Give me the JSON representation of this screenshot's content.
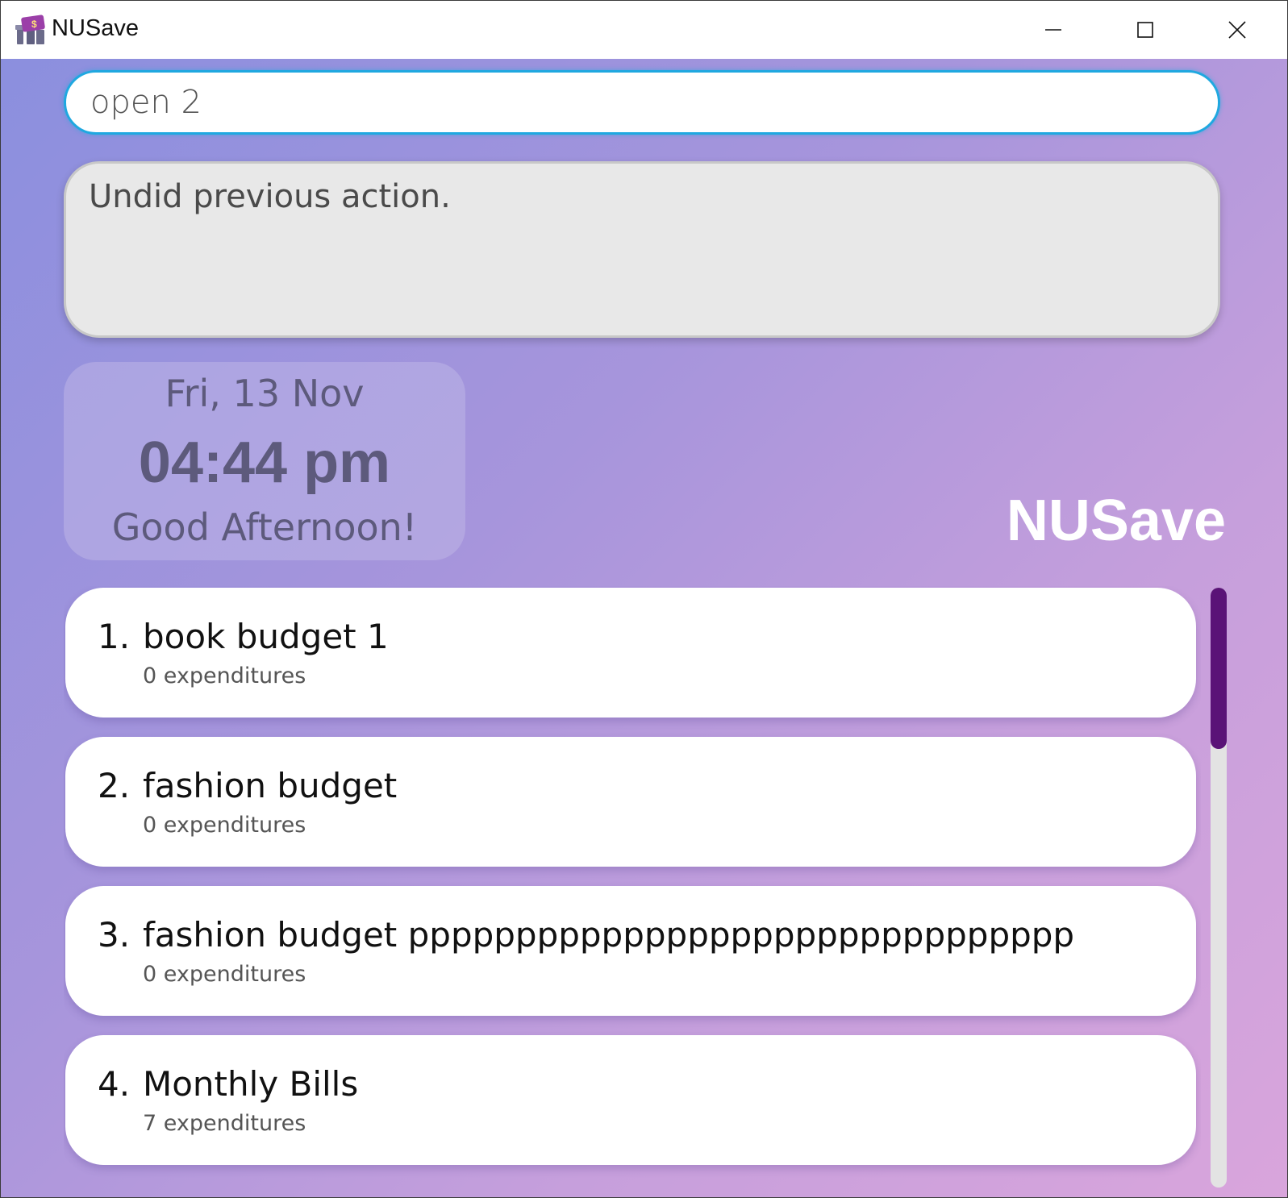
{
  "window": {
    "title": "NUSave",
    "controls": [
      "minimize",
      "maximize",
      "close"
    ]
  },
  "command": {
    "value": "open 2"
  },
  "result": {
    "message": "Undid previous action."
  },
  "clock": {
    "date": "Fri, 13 Nov",
    "time": "04:44 pm",
    "greeting": "Good Afternoon!"
  },
  "brand": {
    "name": "NUSave"
  },
  "budgets": [
    {
      "index": "1.",
      "name": "book budget 1",
      "expenditures": "0 expenditures"
    },
    {
      "index": "2.",
      "name": "fashion budget",
      "expenditures": "0 expenditures"
    },
    {
      "index": "3.",
      "name": "fashion budget ppppppppppppppppppppppppppppppp",
      "expenditures": "0 expenditures"
    },
    {
      "index": "4.",
      "name": "Monthly Bills",
      "expenditures": "7 expenditures"
    }
  ],
  "colors": {
    "accent": "#1fa8e0",
    "scroll_thumb": "#5a1377",
    "gradient_start": "#8b8fde",
    "gradient_end": "#d9a5dc"
  },
  "icons": {
    "app": "money-wallet-icon",
    "minimize": "minimize-icon",
    "maximize": "maximize-icon",
    "close": "close-icon"
  }
}
